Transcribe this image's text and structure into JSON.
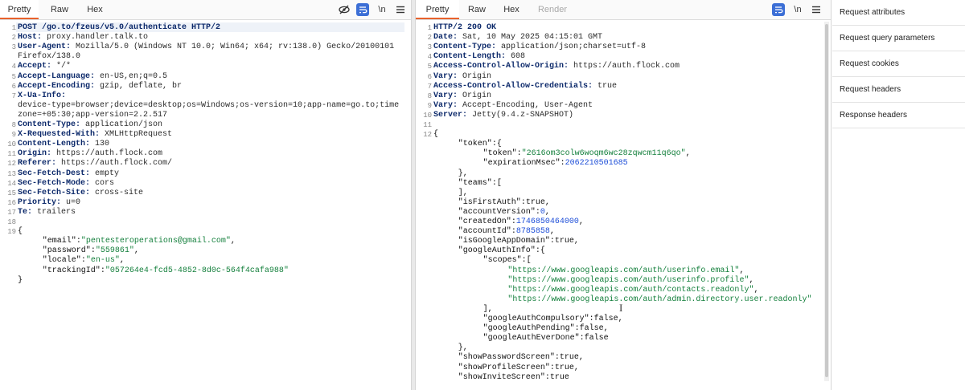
{
  "request_pane": {
    "tabs": [
      "Pretty",
      "Raw",
      "Hex"
    ],
    "active_tab": "Pretty",
    "tools": {
      "hide_icon": "eye-off-icon",
      "wrap_icon": "wrap-lines-icon",
      "newline_label": "\\n",
      "menu_icon": "hamburger-menu-icon"
    },
    "lines": [
      {
        "n": "1",
        "k": "POST /go.to/fzeus/v5.0/authenticate HTTP/2",
        "v": ""
      },
      {
        "n": "2",
        "k": "Host:",
        "v": " proxy.handler.talk.to"
      },
      {
        "n": "3",
        "k": "User-Agent:",
        "v": " Mozilla/5.0 (Windows NT 10.0; Win64; x64; rv:138.0) Gecko/20100101"
      },
      {
        "n": "",
        "k": "",
        "v": "Firefox/138.0"
      },
      {
        "n": "4",
        "k": "Accept:",
        "v": " */*"
      },
      {
        "n": "5",
        "k": "Accept-Language:",
        "v": " en-US,en;q=0.5"
      },
      {
        "n": "6",
        "k": "Accept-Encoding:",
        "v": " gzip, deflate, br"
      },
      {
        "n": "7",
        "k": "X-Ua-Info:",
        "v": ""
      },
      {
        "n": "",
        "k": "",
        "v": "device-type=browser;device=desktop;os=Windows;os-version=10;app-name=go.to;time"
      },
      {
        "n": "",
        "k": "",
        "v": "zone=+05:30;app-version=2.2.517"
      },
      {
        "n": "8",
        "k": "Content-Type:",
        "v": " application/json"
      },
      {
        "n": "9",
        "k": "X-Requested-With:",
        "v": " XMLHttpRequest"
      },
      {
        "n": "10",
        "k": "Content-Length:",
        "v": " 130"
      },
      {
        "n": "11",
        "k": "Origin:",
        "v": " https://auth.flock.com"
      },
      {
        "n": "12",
        "k": "Referer:",
        "v": " https://auth.flock.com/"
      },
      {
        "n": "13",
        "k": "Sec-Fetch-Dest:",
        "v": " empty"
      },
      {
        "n": "14",
        "k": "Sec-Fetch-Mode:",
        "v": " cors"
      },
      {
        "n": "15",
        "k": "Sec-Fetch-Site:",
        "v": " cross-site"
      },
      {
        "n": "16",
        "k": "Priority:",
        "v": " u=0"
      },
      {
        "n": "17",
        "k": "Te:",
        "v": " trailers"
      }
    ],
    "body_lines": [
      {
        "n": "18",
        "indent": 0,
        "parts": []
      },
      {
        "n": "19",
        "indent": 0,
        "parts": [
          {
            "t": "b",
            "s": "{"
          }
        ]
      },
      {
        "n": "",
        "indent": 4,
        "parts": [
          {
            "t": "k",
            "s": "\"email\""
          },
          {
            "t": "b",
            "s": ":"
          },
          {
            "t": "s",
            "s": "\"pentesteroperations@gmail.com\""
          },
          {
            "t": "b",
            "s": ","
          }
        ]
      },
      {
        "n": "",
        "indent": 4,
        "parts": [
          {
            "t": "k",
            "s": "\"password\""
          },
          {
            "t": "b",
            "s": ":"
          },
          {
            "t": "s",
            "s": "\"559861\""
          },
          {
            "t": "b",
            "s": ","
          }
        ]
      },
      {
        "n": "",
        "indent": 4,
        "parts": [
          {
            "t": "k",
            "s": "\"locale\""
          },
          {
            "t": "b",
            "s": ":"
          },
          {
            "t": "s",
            "s": "\"en-us\""
          },
          {
            "t": "b",
            "s": ","
          }
        ]
      },
      {
        "n": "",
        "indent": 4,
        "parts": [
          {
            "t": "k",
            "s": "\"trackingId\""
          },
          {
            "t": "b",
            "s": ":"
          },
          {
            "t": "s",
            "s": "\"057264e4-fcd5-4852-8d0c-564f4cafa988\""
          }
        ]
      },
      {
        "n": "",
        "indent": 0,
        "parts": [
          {
            "t": "b",
            "s": "}"
          }
        ]
      }
    ]
  },
  "response_pane": {
    "tabs": [
      "Pretty",
      "Raw",
      "Hex",
      "Render"
    ],
    "active_tab": "Pretty",
    "tools": {
      "wrap_icon": "wrap-lines-icon",
      "newline_label": "\\n",
      "menu_icon": "hamburger-menu-icon"
    },
    "lines": [
      {
        "n": "1",
        "k": "HTTP/2 200 OK",
        "v": ""
      },
      {
        "n": "2",
        "k": "Date:",
        "v": " Sat, 10 May 2025 04:15:01 GMT"
      },
      {
        "n": "3",
        "k": "Content-Type:",
        "v": " application/json;charset=utf-8"
      },
      {
        "n": "4",
        "k": "Content-Length:",
        "v": " 608"
      },
      {
        "n": "5",
        "k": "Access-Control-Allow-Origin:",
        "v": " https://auth.flock.com"
      },
      {
        "n": "6",
        "k": "Vary:",
        "v": " Origin"
      },
      {
        "n": "7",
        "k": "Access-Control-Allow-Credentials:",
        "v": " true"
      },
      {
        "n": "8",
        "k": "Vary:",
        "v": " Origin"
      },
      {
        "n": "9",
        "k": "Vary:",
        "v": " Accept-Encoding, User-Agent"
      },
      {
        "n": "10",
        "k": "Server:",
        "v": " Jetty(9.4.z-SNAPSHOT)"
      }
    ],
    "body_lines": [
      {
        "n": "11",
        "indent": 0,
        "parts": []
      },
      {
        "n": "12",
        "indent": 0,
        "parts": [
          {
            "t": "b",
            "s": "{"
          }
        ]
      },
      {
        "n": "",
        "indent": 4,
        "parts": [
          {
            "t": "k",
            "s": "\"token\""
          },
          {
            "t": "b",
            "s": ":{"
          }
        ]
      },
      {
        "n": "",
        "indent": 8,
        "parts": [
          {
            "t": "k",
            "s": "\"token\""
          },
          {
            "t": "b",
            "s": ":"
          },
          {
            "t": "s",
            "s": "\"2616om3colw6woqm6wc28zqwcm11q6qo\""
          },
          {
            "t": "b",
            "s": ","
          }
        ]
      },
      {
        "n": "",
        "indent": 8,
        "parts": [
          {
            "t": "k",
            "s": "\"expirationMsec\""
          },
          {
            "t": "b",
            "s": ":"
          },
          {
            "t": "n",
            "s": "2062210501685"
          }
        ]
      },
      {
        "n": "",
        "indent": 4,
        "parts": [
          {
            "t": "b",
            "s": "},"
          }
        ]
      },
      {
        "n": "",
        "indent": 4,
        "parts": [
          {
            "t": "k",
            "s": "\"teams\""
          },
          {
            "t": "b",
            "s": ":["
          }
        ]
      },
      {
        "n": "",
        "indent": 4,
        "parts": [
          {
            "t": "b",
            "s": "],"
          }
        ]
      },
      {
        "n": "",
        "indent": 4,
        "parts": [
          {
            "t": "k",
            "s": "\"isFirstAuth\""
          },
          {
            "t": "b",
            "s": ":true,"
          }
        ]
      },
      {
        "n": "",
        "indent": 4,
        "parts": [
          {
            "t": "k",
            "s": "\"accountVersion\""
          },
          {
            "t": "b",
            "s": ":"
          },
          {
            "t": "n",
            "s": "0"
          },
          {
            "t": "b",
            "s": ","
          }
        ]
      },
      {
        "n": "",
        "indent": 4,
        "parts": [
          {
            "t": "k",
            "s": "\"createdOn\""
          },
          {
            "t": "b",
            "s": ":"
          },
          {
            "t": "n",
            "s": "1746850464000"
          },
          {
            "t": "b",
            "s": ","
          }
        ]
      },
      {
        "n": "",
        "indent": 4,
        "parts": [
          {
            "t": "k",
            "s": "\"accountId\""
          },
          {
            "t": "b",
            "s": ":"
          },
          {
            "t": "n",
            "s": "8785858"
          },
          {
            "t": "b",
            "s": ","
          }
        ]
      },
      {
        "n": "",
        "indent": 4,
        "parts": [
          {
            "t": "k",
            "s": "\"isGoogleAppDomain\""
          },
          {
            "t": "b",
            "s": ":true,"
          }
        ]
      },
      {
        "n": "",
        "indent": 4,
        "parts": [
          {
            "t": "k",
            "s": "\"googleAuthInfo\""
          },
          {
            "t": "b",
            "s": ":{"
          }
        ]
      },
      {
        "n": "",
        "indent": 8,
        "parts": [
          {
            "t": "k",
            "s": "\"scopes\""
          },
          {
            "t": "b",
            "s": ":["
          }
        ]
      },
      {
        "n": "",
        "indent": 12,
        "parts": [
          {
            "t": "s",
            "s": "\"https://www.googleapis.com/auth/userinfo.email\""
          },
          {
            "t": "b",
            "s": ","
          }
        ]
      },
      {
        "n": "",
        "indent": 12,
        "parts": [
          {
            "t": "s",
            "s": "\"https://www.googleapis.com/auth/userinfo.profile\""
          },
          {
            "t": "b",
            "s": ","
          }
        ]
      },
      {
        "n": "",
        "indent": 12,
        "parts": [
          {
            "t": "s",
            "s": "\"https://www.googleapis.com/auth/contacts.readonly\""
          },
          {
            "t": "b",
            "s": ","
          }
        ]
      },
      {
        "n": "",
        "indent": 12,
        "parts": [
          {
            "t": "s",
            "s": "\"https://www.googleapis.com/auth/admin.directory.user.readonly\""
          }
        ]
      },
      {
        "n": "",
        "indent": 8,
        "parts": [
          {
            "t": "b",
            "s": "],"
          }
        ]
      },
      {
        "n": "",
        "indent": 8,
        "parts": [
          {
            "t": "k",
            "s": "\"googleAuthCompulsory\""
          },
          {
            "t": "b",
            "s": ":false,"
          }
        ]
      },
      {
        "n": "",
        "indent": 8,
        "parts": [
          {
            "t": "k",
            "s": "\"googleAuthPending\""
          },
          {
            "t": "b",
            "s": ":false,"
          }
        ]
      },
      {
        "n": "",
        "indent": 8,
        "parts": [
          {
            "t": "k",
            "s": "\"googleAuthEverDone\""
          },
          {
            "t": "b",
            "s": ":false"
          }
        ]
      },
      {
        "n": "",
        "indent": 4,
        "parts": [
          {
            "t": "b",
            "s": "},"
          }
        ]
      },
      {
        "n": "",
        "indent": 4,
        "parts": [
          {
            "t": "k",
            "s": "\"showPasswordScreen\""
          },
          {
            "t": "b",
            "s": ":true,"
          }
        ]
      },
      {
        "n": "",
        "indent": 4,
        "parts": [
          {
            "t": "k",
            "s": "\"showProfileScreen\""
          },
          {
            "t": "b",
            "s": ":true,"
          }
        ]
      },
      {
        "n": "",
        "indent": 4,
        "parts": [
          {
            "t": "k",
            "s": "\"showInviteScreen\""
          },
          {
            "t": "b",
            "s": ":true"
          }
        ]
      }
    ]
  },
  "inspector": {
    "items": [
      "Request attributes",
      "Request query parameters",
      "Request cookies",
      "Request headers",
      "Response headers"
    ]
  },
  "colors": {
    "accent": "#e8622c",
    "selected_tool": "#3c6fd6",
    "json_string": "#15803d",
    "json_number": "#1d4ed8",
    "header_key": "#0d2a6b"
  }
}
